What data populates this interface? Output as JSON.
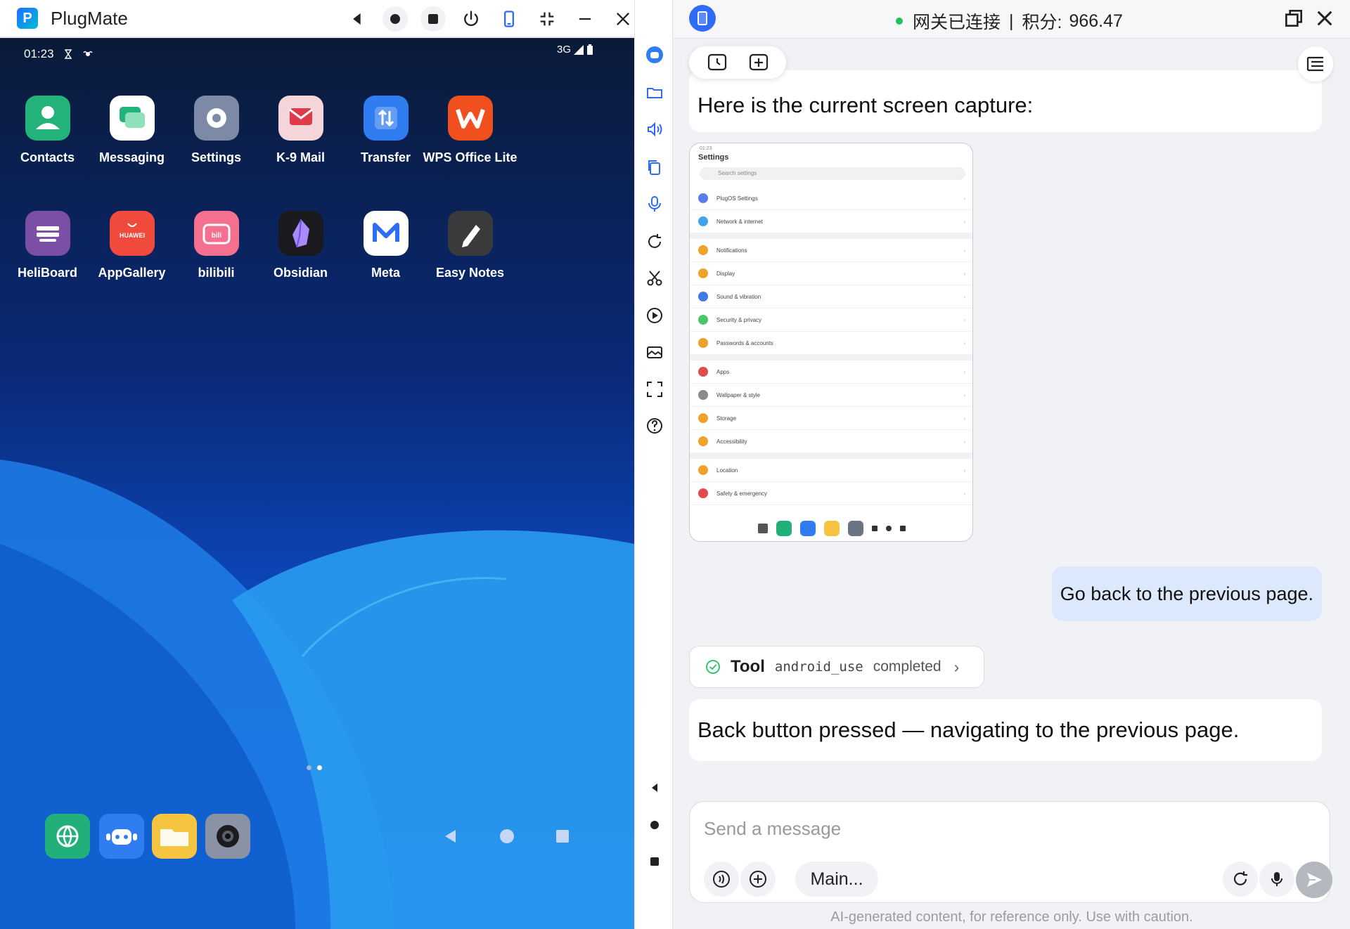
{
  "app": {
    "title": "PlugMate",
    "logo_icon": "plugmate-logo-icon"
  },
  "window_controls": [
    "back-icon",
    "home-icon",
    "stop-icon",
    "power-icon",
    "phone-icon",
    "shrink-icon",
    "minimize-icon",
    "close-icon",
    "collapse-icon"
  ],
  "phone": {
    "time": "01:23",
    "network": "3G",
    "apps": [
      {
        "label": "Contacts",
        "icon": "contacts-icon",
        "color": "#23b27a"
      },
      {
        "label": "Messaging",
        "icon": "messaging-icon",
        "color": "#ffffff"
      },
      {
        "label": "Settings",
        "icon": "settings-gear-icon",
        "color": "#7d8aa6"
      },
      {
        "label": "K-9 Mail",
        "icon": "k9-mail-icon",
        "color": "#f4d6da"
      },
      {
        "label": "Transfer",
        "icon": "transfer-icon",
        "color": "#2f7df0"
      },
      {
        "label": "WPS Office Lite",
        "icon": "wps-office-icon",
        "color": "#f0501e"
      },
      {
        "label": "HeliBoard",
        "icon": "heliboard-icon",
        "color": "#7b4fa6"
      },
      {
        "label": "AppGallery",
        "icon": "appgallery-icon",
        "color": "#ef4a3c"
      },
      {
        "label": "bilibili",
        "icon": "bilibili-icon",
        "color": "#f5708f"
      },
      {
        "label": "Obsidian",
        "icon": "obsidian-icon",
        "color": "#1b1b1f"
      },
      {
        "label": "Meta",
        "icon": "meta-mail-icon",
        "color": "#ffffff"
      },
      {
        "label": "Easy Notes",
        "icon": "easy-notes-icon",
        "color": "#3a3a3c"
      }
    ],
    "dock": [
      {
        "icon": "browser-globe-icon",
        "color": "#22b07a"
      },
      {
        "icon": "plugmate-robot-icon",
        "color": "#2f7df0"
      },
      {
        "icon": "files-folder-icon",
        "color": "#f5c542"
      },
      {
        "icon": "camera-icon",
        "color": "#8a93a6"
      }
    ]
  },
  "sidebar": [
    "assistant-avatar-icon",
    "folder-icon",
    "volume-icon",
    "copy-icon",
    "microphone-icon",
    "rotate-icon",
    "scissors-icon",
    "play-icon",
    "gallery-icon",
    "fullscreen-icon",
    "help-icon",
    "back-icon",
    "home-icon",
    "stop-icon"
  ],
  "chat": {
    "header": {
      "status_text": "网关已连接",
      "separator": "|",
      "points_label": "积分:",
      "points_value": "966.47",
      "status_color": "#21c25e"
    },
    "messages": {
      "capture": "Here is the current screen capture:",
      "user": "Go back to the previous page.",
      "tool": {
        "label": "Tool",
        "name": "android_use",
        "status": "completed"
      },
      "reply": "Back button pressed — navigating to the previous page."
    },
    "screenshot": {
      "title": "Settings",
      "search_placeholder": "Search settings",
      "rows": [
        {
          "label": "PlugOS Settings",
          "color": "#5a7be8"
        },
        {
          "label": "Network & internet",
          "color": "#3fa5e8"
        },
        {
          "label": "Notifications",
          "color": "#f0a12a"
        },
        {
          "label": "Display",
          "color": "#f0a12a"
        },
        {
          "label": "Sound & vibration",
          "color": "#3f7be8"
        },
        {
          "label": "Security & privacy",
          "color": "#4bc46a"
        },
        {
          "label": "Passwords & accounts",
          "color": "#f0a12a"
        },
        {
          "label": "Apps",
          "color": "#e04b4b"
        },
        {
          "label": "Wallpaper & style",
          "color": "#8a8a8a"
        },
        {
          "label": "Storage",
          "color": "#f0a12a"
        },
        {
          "label": "Accessibility",
          "color": "#f0a12a"
        },
        {
          "label": "Location",
          "color": "#f0a12a"
        },
        {
          "label": "Safety & emergency",
          "color": "#e04b4b"
        }
      ]
    },
    "composer": {
      "placeholder": "Send a message",
      "model": "Main..."
    },
    "disclaimer": "AI-generated content, for reference only. Use with caution."
  }
}
